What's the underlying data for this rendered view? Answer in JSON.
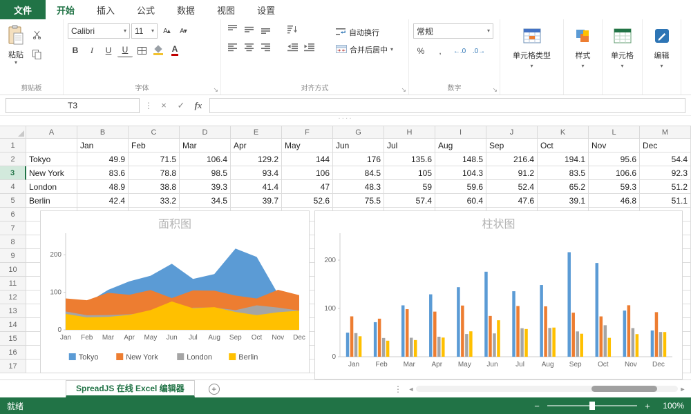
{
  "tabs": [
    {
      "label": "文件"
    },
    {
      "label": "开始"
    },
    {
      "label": "插入"
    },
    {
      "label": "公式"
    },
    {
      "label": "数据"
    },
    {
      "label": "视图"
    },
    {
      "label": "设置"
    }
  ],
  "ribbon": {
    "clipboard": {
      "paste": "粘贴",
      "group": "剪贴板"
    },
    "font": {
      "name": "Calibri",
      "size": "11",
      "bold": "B",
      "italic": "I",
      "underline": "U",
      "double_underline": "U",
      "color_letter": "A",
      "group": "字体"
    },
    "alignment": {
      "wrap": "自动换行",
      "merge": "合并后居中",
      "group": "对齐方式"
    },
    "number": {
      "format": "常规",
      "group": "数字"
    },
    "cell_type": "单元格类型",
    "style": "样式",
    "cells": "单元格",
    "edit": "编辑"
  },
  "formula_bar": {
    "name_box": "T3",
    "formula": ""
  },
  "icons": {
    "dropdown": "▾",
    "more": "⋮",
    "cancel": "×",
    "confirm": "✓",
    "fx": "fx",
    "launcher": "↘",
    "scroll_left": "◄",
    "scroll_right": "►",
    "zoom_out": "−",
    "zoom_in": "+",
    "splitter": "····",
    "percent": "%",
    "comma": ",",
    "inc_decimal": "←.0",
    "dec_decimal": ".0→",
    "font_larger": "A▴",
    "font_smaller": "A▾"
  },
  "grid": {
    "col_headers": [
      "A",
      "B",
      "C",
      "D",
      "E",
      "F",
      "G",
      "H",
      "I",
      "J",
      "K",
      "L",
      "M"
    ],
    "row_count": 17,
    "selected_row": 3,
    "rows": [
      {
        "r": 1,
        "cells": [
          "",
          "Jan",
          "Feb",
          "Mar",
          "Apr",
          "May",
          "Jun",
          "Jul",
          "Aug",
          "Sep",
          "Oct",
          "Nov",
          "Dec"
        ]
      },
      {
        "r": 2,
        "cells": [
          "Tokyo",
          "49.9",
          "71.5",
          "106.4",
          "129.2",
          "144",
          "176",
          "135.6",
          "148.5",
          "216.4",
          "194.1",
          "95.6",
          "54.4"
        ]
      },
      {
        "r": 3,
        "cells": [
          "New York",
          "83.6",
          "78.8",
          "98.5",
          "93.4",
          "106",
          "84.5",
          "105",
          "104.3",
          "91.2",
          "83.5",
          "106.6",
          "92.3"
        ]
      },
      {
        "r": 4,
        "cells": [
          "London",
          "48.9",
          "38.8",
          "39.3",
          "41.4",
          "47",
          "48.3",
          "59",
          "59.6",
          "52.4",
          "65.2",
          "59.3",
          "51.2"
        ]
      },
      {
        "r": 5,
        "cells": [
          "Berlin",
          "42.4",
          "33.2",
          "34.5",
          "39.7",
          "52.6",
          "75.5",
          "57.4",
          "60.4",
          "47.6",
          "39.1",
          "46.8",
          "51.1"
        ]
      }
    ]
  },
  "chart_data": [
    {
      "type": "area",
      "title": "面积图",
      "categories": [
        "Jan",
        "Feb",
        "Mar",
        "Apr",
        "May",
        "Jun",
        "Jul",
        "Aug",
        "Sep",
        "Oct",
        "Nov",
        "Dec"
      ],
      "series": [
        {
          "name": "Tokyo",
          "color": "#5B9BD5",
          "values": [
            49.9,
            71.5,
            106.4,
            129.2,
            144,
            176,
            135.6,
            148.5,
            216.4,
            194.1,
            95.6,
            54.4
          ]
        },
        {
          "name": "New York",
          "color": "#ED7D31",
          "values": [
            83.6,
            78.8,
            98.5,
            93.4,
            106,
            84.5,
            105,
            104.3,
            91.2,
            83.5,
            106.6,
            92.3
          ]
        },
        {
          "name": "London",
          "color": "#A5A5A5",
          "values": [
            48.9,
            38.8,
            39.3,
            41.4,
            47,
            48.3,
            59,
            59.6,
            52.4,
            65.2,
            59.3,
            51.2
          ]
        },
        {
          "name": "Berlin",
          "color": "#FFC000",
          "values": [
            42.4,
            33.2,
            34.5,
            39.7,
            52.6,
            75.5,
            57.4,
            60.4,
            47.6,
            39.1,
            46.8,
            51.1
          ]
        }
      ],
      "ylim": [
        0,
        250
      ],
      "yticks": [
        0,
        100,
        200
      ],
      "legend": true,
      "legend_position": "bottom"
    },
    {
      "type": "bar",
      "title": "柱状图",
      "categories": [
        "Jan",
        "Feb",
        "Mar",
        "Apr",
        "May",
        "Jun",
        "Jul",
        "Aug",
        "Sep",
        "Oct",
        "Nov",
        "Dec"
      ],
      "series": [
        {
          "name": "Tokyo",
          "color": "#5B9BD5",
          "values": [
            49.9,
            71.5,
            106.4,
            129.2,
            144,
            176,
            135.6,
            148.5,
            216.4,
            194.1,
            95.6,
            54.4
          ]
        },
        {
          "name": "New York",
          "color": "#ED7D31",
          "values": [
            83.6,
            78.8,
            98.5,
            93.4,
            106,
            84.5,
            105,
            104.3,
            91.2,
            83.5,
            106.6,
            92.3
          ]
        },
        {
          "name": "London",
          "color": "#A5A5A5",
          "values": [
            48.9,
            38.8,
            39.3,
            41.4,
            47,
            48.3,
            59,
            59.6,
            52.4,
            65.2,
            59.3,
            51.2
          ]
        },
        {
          "name": "Berlin",
          "color": "#FFC000",
          "values": [
            42.4,
            33.2,
            34.5,
            39.7,
            52.6,
            75.5,
            57.4,
            60.4,
            47.6,
            39.1,
            46.8,
            51.1
          ]
        }
      ],
      "ylim": [
        0,
        250
      ],
      "yticks": [
        0,
        100,
        200
      ],
      "legend": false
    }
  ],
  "sheet_bar": {
    "tab": "SpreadJS 在线 Excel 编辑器",
    "add": "+"
  },
  "status_bar": {
    "ready": "就绪",
    "zoom": "100%"
  }
}
